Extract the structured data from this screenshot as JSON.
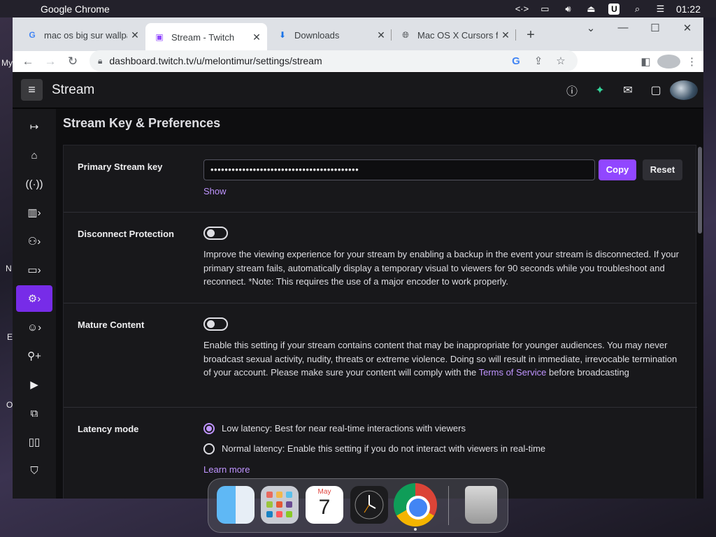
{
  "menubar": {
    "app_name": "Google Chrome",
    "clock": "01:22",
    "u_badge": "U"
  },
  "desktop": {
    "labels": [
      "My",
      "N",
      "E",
      "O"
    ]
  },
  "tabs": [
    {
      "title": "mac os big sur wallpa",
      "icon": "google-icon",
      "active": false
    },
    {
      "title": "Stream - Twitch",
      "icon": "twitch-icon",
      "active": true
    },
    {
      "title": "Downloads",
      "icon": "download-icon",
      "active": false
    },
    {
      "title": "Mac OS X Cursors for",
      "icon": "globe-icon",
      "active": false
    }
  ],
  "address_bar": {
    "url": "dashboard.twitch.tv/u/melontimur/settings/stream"
  },
  "twitch": {
    "header_title": "Stream",
    "page_heading": "Stream Key & Preferences",
    "stream_key": {
      "label": "Primary Stream key",
      "masked_value": "••••••••••••••••••••••••••••••••••••••••••",
      "copy_label": "Copy",
      "reset_label": "Reset",
      "show_label": "Show"
    },
    "disconnect_protection": {
      "label": "Disconnect Protection",
      "enabled": false,
      "description": "Improve the viewing experience for your stream by enabling a backup in the event your stream is disconnected. If your primary stream fails, automatically display a temporary visual to viewers for 90 seconds while you troubleshoot and reconnect. *Note: This requires the use of a major encoder to work properly."
    },
    "mature_content": {
      "label": "Mature Content",
      "enabled": false,
      "description_before": "Enable this setting if your stream contains content that may be inappropriate for younger audiences. You may never broadcast sexual activity, nudity, threats or extreme violence. Doing so will result in immediate, irrevocable termination of your account. Please make sure your content will comply with the ",
      "tos_link": "Terms of Service",
      "description_after": " before broadcasting"
    },
    "latency_mode": {
      "label": "Latency mode",
      "options": [
        {
          "label": "Low latency: Best for near real-time interactions with viewers",
          "selected": true
        },
        {
          "label": "Normal latency: Enable this setting if you do not interact with viewers in real-time",
          "selected": false
        }
      ],
      "learn_more": "Learn more"
    }
  },
  "dock": {
    "calendar_month": "May",
    "calendar_day": "7"
  },
  "colors": {
    "twitch_purple": "#9147ff",
    "link_purple": "#bf94ff",
    "sidebar_active": "#772ce8"
  }
}
